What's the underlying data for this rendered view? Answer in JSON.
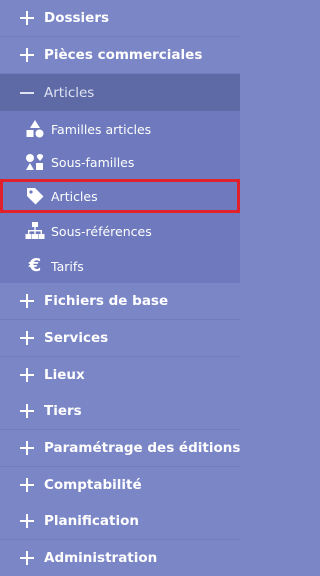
{
  "sections_top": [
    {
      "label": "Dossiers",
      "icon": "plus-icon"
    },
    {
      "label": "Pièces commerciales",
      "icon": "plus-icon"
    }
  ],
  "open_section": {
    "label": "Articles",
    "icon": "minus-icon"
  },
  "sub_items": [
    {
      "label": "Familles articles",
      "icon": "shapes-icon"
    },
    {
      "label": "Sous-familles",
      "icon": "shapes-alt-icon"
    },
    {
      "label": "Articles",
      "icon": "tag-icon",
      "selected": true
    },
    {
      "label": "Sous-références",
      "icon": "sitemap-icon"
    },
    {
      "label": "Tarifs",
      "icon": "euro-icon"
    }
  ],
  "sections_bottom": [
    {
      "label": "Fichiers de base",
      "icon": "plus-icon"
    },
    {
      "label": "Services",
      "icon": "plus-icon"
    },
    {
      "label": "Lieux",
      "icon": "plus-icon"
    },
    {
      "label": "Tiers",
      "icon": "plus-icon"
    },
    {
      "label": "Paramétrage des éditions",
      "icon": "plus-icon"
    },
    {
      "label": "Comptabilité",
      "icon": "plus-icon"
    },
    {
      "label": "Planification",
      "icon": "plus-icon"
    },
    {
      "label": "Administration",
      "icon": "plus-icon"
    }
  ],
  "colors": {
    "sidebar_bg": "#7b86c7",
    "open_section_bg": "#5e6aa6",
    "sub_bg": "#6e7abd",
    "selection_outline": "#e0202a",
    "text": "#ffffff"
  }
}
